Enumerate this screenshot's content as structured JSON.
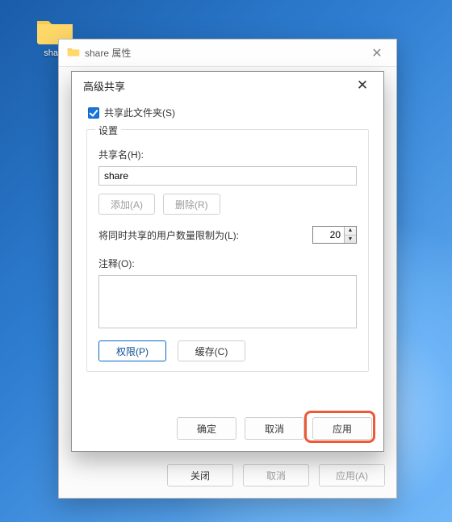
{
  "desktopIcon": {
    "label": "share"
  },
  "propsWindow": {
    "title": "share 属性",
    "buttons": {
      "close": "关闭",
      "cancel": "取消",
      "apply": "应用(A)"
    }
  },
  "advDialog": {
    "title": "高级共享",
    "shareThisFolder": "共享此文件夹(S)",
    "settingsLegend": "设置",
    "shareNameLabel": "共享名(H):",
    "shareNameValue": "share",
    "addBtn": "添加(A)",
    "removeBtn": "删除(R)",
    "limitLabel": "将同时共享的用户数量限制为(L):",
    "limitValue": "20",
    "commentLabel": "注释(O):",
    "commentValue": "",
    "permBtn": "权限(P)",
    "cacheBtn": "缓存(C)",
    "ok": "确定",
    "cancel": "取消",
    "apply": "应用"
  }
}
